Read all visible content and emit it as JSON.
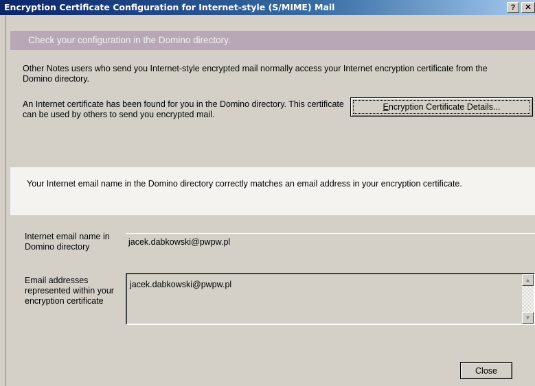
{
  "window": {
    "title": "Encryption Certificate Configuration for Internet-style (S/MIME) Mail",
    "help_label": "?",
    "close_label": "✕"
  },
  "header": {
    "text": "Check your configuration in the Domino directory."
  },
  "intro_text": "Other Notes users who send you Internet-style encrypted mail normally access your Internet encryption certificate from the Domino directory.",
  "found_text": "An Internet certificate has been found for you in the Domino directory. This certificate can be used by others to send you encrypted mail.",
  "details_button": {
    "label_prefix": "",
    "label_accel": "E",
    "label_rest": "ncryption Certificate Details..."
  },
  "match_text": "Your Internet email name in the Domino directory correctly matches an email address in your encryption certificate.",
  "email_name": {
    "label": "Internet email name in Domino directory",
    "value": "jacek.dabkowski@pwpw.pl"
  },
  "cert_addresses": {
    "label": "Email addresses represented within your encryption certificate",
    "value": "jacek.dabkowski@pwpw.pl"
  },
  "close_button": {
    "label": "Close"
  },
  "colors": {
    "title_bar": "#0a246a",
    "header_band": "#b8a8b7",
    "dialog_bg": "#d4d0c8",
    "match_band": "#f5f3ef"
  }
}
